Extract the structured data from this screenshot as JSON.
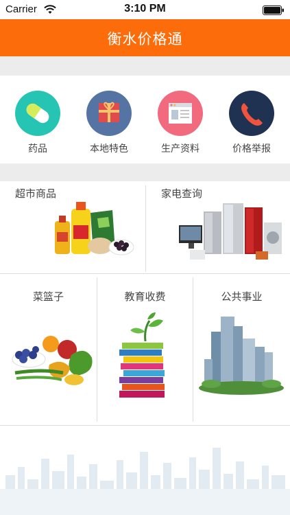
{
  "status": {
    "carrier": "Carrier",
    "time": "3:10 PM"
  },
  "nav": {
    "title": "衡水价格通"
  },
  "categories": [
    {
      "label": "药品",
      "icon": "pill-icon",
      "color": "#25c4b3"
    },
    {
      "label": "本地特色",
      "icon": "gift-icon",
      "color": "#5674a3"
    },
    {
      "label": "生产资料",
      "icon": "browser-window-icon",
      "color": "#f16a7e"
    },
    {
      "label": "价格举报",
      "icon": "phone-icon",
      "color": "#203252"
    }
  ],
  "tiles_top": [
    {
      "label": "超市商品"
    },
    {
      "label": "家电查询"
    }
  ],
  "tiles_bottom": [
    {
      "label": "菜篮子"
    },
    {
      "label": "教育收费"
    },
    {
      "label": "公共事业"
    }
  ],
  "colors": {
    "accent": "#fc6c0a",
    "background": "#ececec"
  }
}
